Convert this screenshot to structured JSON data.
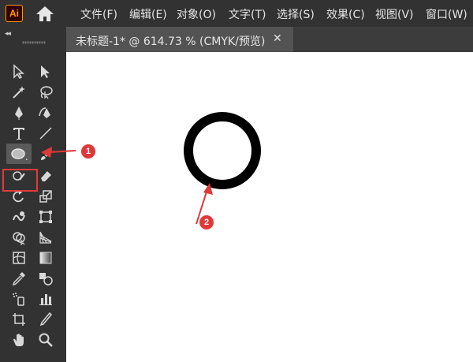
{
  "app": {
    "logo_text": "Ai",
    "brand_color": "#ff9a00"
  },
  "menu": [
    "文件(F)",
    "编辑(E)",
    "对象(O)",
    "文字(T)",
    "选择(S)",
    "效果(C)",
    "视图(V)",
    "窗口(W)"
  ],
  "panel": {
    "collapse_label": "◂◂"
  },
  "document_tab": {
    "title": "未标题-1* @ 614.73 % (CMYK/预览)",
    "close_label": "✕"
  },
  "annotations": [
    {
      "label": "1",
      "color": "#e03838"
    },
    {
      "label": "2",
      "color": "#e03838"
    }
  ],
  "tools": [
    "selection",
    "direct-selection",
    "magic-wand",
    "lasso",
    "pen",
    "curvature",
    "type",
    "line-segment",
    "ellipse",
    "paintbrush",
    "shaper",
    "eraser",
    "rotate",
    "scale",
    "warp",
    "free-transform",
    "shape-builder",
    "perspective-grid",
    "mesh",
    "gradient",
    "eyedropper",
    "blend",
    "symbol-sprayer",
    "column-graph",
    "artboard",
    "slice",
    "hand",
    "zoom"
  ],
  "canvas": {
    "shape": "ellipse",
    "stroke_color": "#000000",
    "fill": "none"
  }
}
